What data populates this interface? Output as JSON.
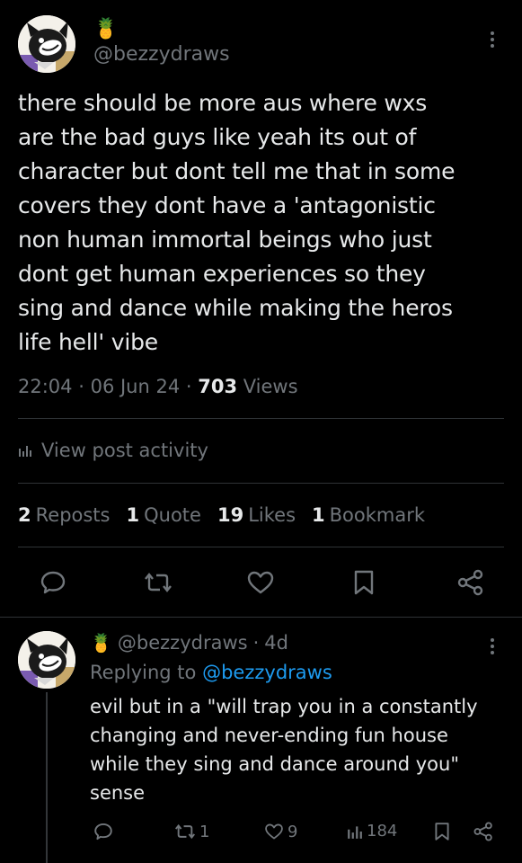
{
  "main_post": {
    "avatar_icon": "cartoon-character-avatar",
    "badge_emoji": "🍍",
    "handle": "@bezzydraws",
    "text": "there should be more aus where wxs\nare the bad guys like yeah its out of\ncharacter but dont tell me that in some\ncovers they dont have a 'antagonistic\nnon human immortal beings who just\ndont get human experiences so they\nsing and dance while making the heros\nlife hell' vibe",
    "time": "22:04",
    "date": "06 Jun 24",
    "views_count": "703",
    "views_label": "Views",
    "view_activity_label": "View post activity",
    "stats": {
      "reposts_count": "2",
      "reposts_label": "Reposts",
      "quotes_count": "1",
      "quotes_label": "Quote",
      "likes_count": "19",
      "likes_label": "Likes",
      "bookmarks_count": "1",
      "bookmarks_label": "Bookmark"
    }
  },
  "reply": {
    "badge_emoji": "🍍",
    "handle": "@bezzydraws",
    "age": "4d",
    "replying_to_label": "Replying to",
    "replying_to_handle": "@bezzydraws",
    "text": "evil but in a \"will trap you in a constantly\nchanging and never-ending fun house\nwhile they sing and dance around you\"\nsense",
    "reposts": "1",
    "likes": "9",
    "views": "184"
  },
  "colors": {
    "background": "#000000",
    "text": "#e7e9ea",
    "muted": "#71767b",
    "link": "#1d9bf0",
    "divider": "#2f3336"
  }
}
